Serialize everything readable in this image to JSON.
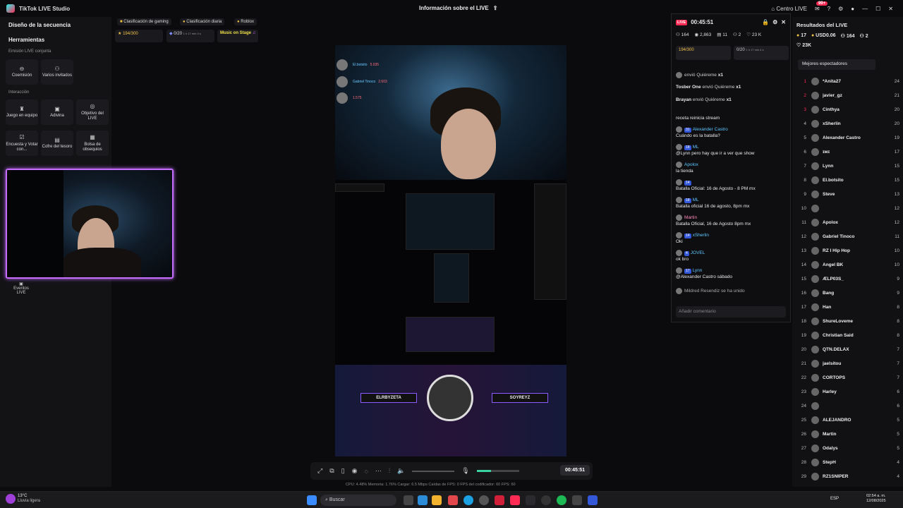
{
  "window": {
    "app_title": "TikTok LIVE Studio",
    "center_title": "Información sobre el LIVE",
    "center_hub": "Centro LIVE",
    "badge": "99+"
  },
  "left": {
    "sequence_title": "Diseño de la secuencia",
    "tools_title": "Herramientas",
    "joint_live": "Emisión LIVE conjunta",
    "tile_comultion": "Coemisión",
    "tile_guests": "Varios invitados",
    "interaction": "Interacción",
    "tile_team": "Juego en equipo",
    "tile_guess": "Adivina",
    "tile_goal": "Objetivo del LIVE",
    "tile_poll": "Encuesta y Votar con...",
    "tile_chest": "Cofre del tesoro",
    "tile_gifts": "Bolsa de obsequios",
    "events": "Eventos LIVE"
  },
  "top": {
    "chip_gaming": "Clasificación de gaming",
    "chip_daily": "Clasificación diaria",
    "chip_roblox": "Roblox",
    "goal1": "194/300",
    "goal2": "0/20",
    "goal2_time": "1 h 17 min 4 s",
    "music": "Music on Stage"
  },
  "stream": {
    "overlay_names": [
      "El.botsito",
      "Gabriel Tinoco",
      ""
    ],
    "overlay_values": [
      "5.035",
      "2.603",
      "1.575"
    ],
    "banner_left": "ELRBYZETA",
    "banner_right": "SOYREYZ"
  },
  "controls": {
    "timer": "00:45:51"
  },
  "stats_line": "CPU: 4.48%     Memoria: 1.76%     Cargar: 6.5 Mbps     Caídas de FPS: 0     FPS del codificador: 60     FPS: 60",
  "chat": {
    "live": "LIVE",
    "time": "00:45:51",
    "stats": [
      "164",
      "2,863",
      "11",
      "2",
      "23 K"
    ],
    "goal1": "194/300",
    "goal2": "0/20",
    "goal2_time": "1 h 17 min 4 s",
    "gifts": [
      {
        "user": "",
        "text": "envió Quiéreme",
        "count": "x1"
      },
      {
        "user": "Tosber One",
        "text": "envió Quiéreme",
        "count": "x1"
      },
      {
        "user": "Brayan",
        "text": "envió Quiéreme",
        "count": "x1"
      }
    ],
    "messages": [
      {
        "level": "",
        "user": "",
        "text": "receta reinicia stream"
      },
      {
        "level": "31",
        "user": "Alexander Castro",
        "text": "Cuándo es la batalla?"
      },
      {
        "level": "18",
        "user": "ML",
        "text": "@Lynn pero hay que ir a ver que show"
      },
      {
        "level": "",
        "user": "Apolox",
        "text": "la tienda"
      },
      {
        "level": "14",
        "user": "",
        "text": "Batalla Oficial: 16 de Agosto - 8 PM mx"
      },
      {
        "level": "18",
        "user": "ML",
        "text": "Batalla oficial 16 de agosto, 8pm mx"
      },
      {
        "level": "",
        "user": "Martin",
        "text": "Batalla Oficial, 16 de Agosto 8pm mx"
      },
      {
        "level": "14",
        "user": "xSherlin",
        "text": "Oki"
      },
      {
        "level": "4",
        "user": "JOVEL",
        "text": "ok bro"
      },
      {
        "level": "17",
        "user": "Lynn",
        "text": "@Alexander Castro sábado"
      },
      {
        "level": "",
        "user": "Mildred Resendiz",
        "text": "se ha unido"
      }
    ],
    "comment_placeholder": "Añadir comentario"
  },
  "results": {
    "title": "Resultados del LIVE",
    "stats": [
      "17",
      "USD0.06",
      "164",
      "2",
      "23K"
    ],
    "top_viewers": "Mejores espectadores",
    "ranks": [
      {
        "n": "1",
        "name": "*Anita27",
        "score": "24"
      },
      {
        "n": "2",
        "name": "javier_gz",
        "score": "21"
      },
      {
        "n": "3",
        "name": "Cinthya",
        "score": "20"
      },
      {
        "n": "4",
        "name": "xSherlin",
        "score": "20"
      },
      {
        "n": "5",
        "name": "Alexander Castro",
        "score": "19"
      },
      {
        "n": "6",
        "name": "ɪᴍɪ",
        "score": "17"
      },
      {
        "n": "7",
        "name": "Lynn",
        "score": "15"
      },
      {
        "n": "8",
        "name": "El.botsito",
        "score": "15"
      },
      {
        "n": "9",
        "name": "Steve",
        "score": "13"
      },
      {
        "n": "10",
        "name": "",
        "score": "12"
      },
      {
        "n": "11",
        "name": "Apolox",
        "score": "12"
      },
      {
        "n": "12",
        "name": "Gabriel Tinoco",
        "score": "11"
      },
      {
        "n": "13",
        "name": "RZ I Hip Hop",
        "score": "10"
      },
      {
        "n": "14",
        "name": "Angel BK",
        "score": "10"
      },
      {
        "n": "15",
        "name": "ÆLP03S_",
        "score": "9"
      },
      {
        "n": "16",
        "name": "Bang",
        "score": "9"
      },
      {
        "n": "17",
        "name": "Han",
        "score": "8"
      },
      {
        "n": "18",
        "name": "ShureLoveme",
        "score": "8"
      },
      {
        "n": "19",
        "name": "Christian Said",
        "score": "8"
      },
      {
        "n": "20",
        "name": "QTN.DELAX",
        "score": "7"
      },
      {
        "n": "21",
        "name": "jaelsitou",
        "score": "7"
      },
      {
        "n": "22",
        "name": "CORTOPS",
        "score": "7"
      },
      {
        "n": "23",
        "name": "Harley",
        "score": "6"
      },
      {
        "n": "24",
        "name": "",
        "score": "6"
      },
      {
        "n": "25",
        "name": "ALEJANDRO",
        "score": "5"
      },
      {
        "n": "26",
        "name": "Martin",
        "score": "5"
      },
      {
        "n": "27",
        "name": "Odalys",
        "score": "5"
      },
      {
        "n": "28",
        "name": "StepH",
        "score": "4"
      },
      {
        "n": "29",
        "name": "RZ1SNIPER",
        "score": "4"
      }
    ]
  },
  "taskbar": {
    "weather_temp": "13°C",
    "weather_desc": "Lluvia ligera",
    "search": "Buscar",
    "lang": "ESP",
    "time": "02:54 a. m.",
    "date": "12/08/2025"
  }
}
